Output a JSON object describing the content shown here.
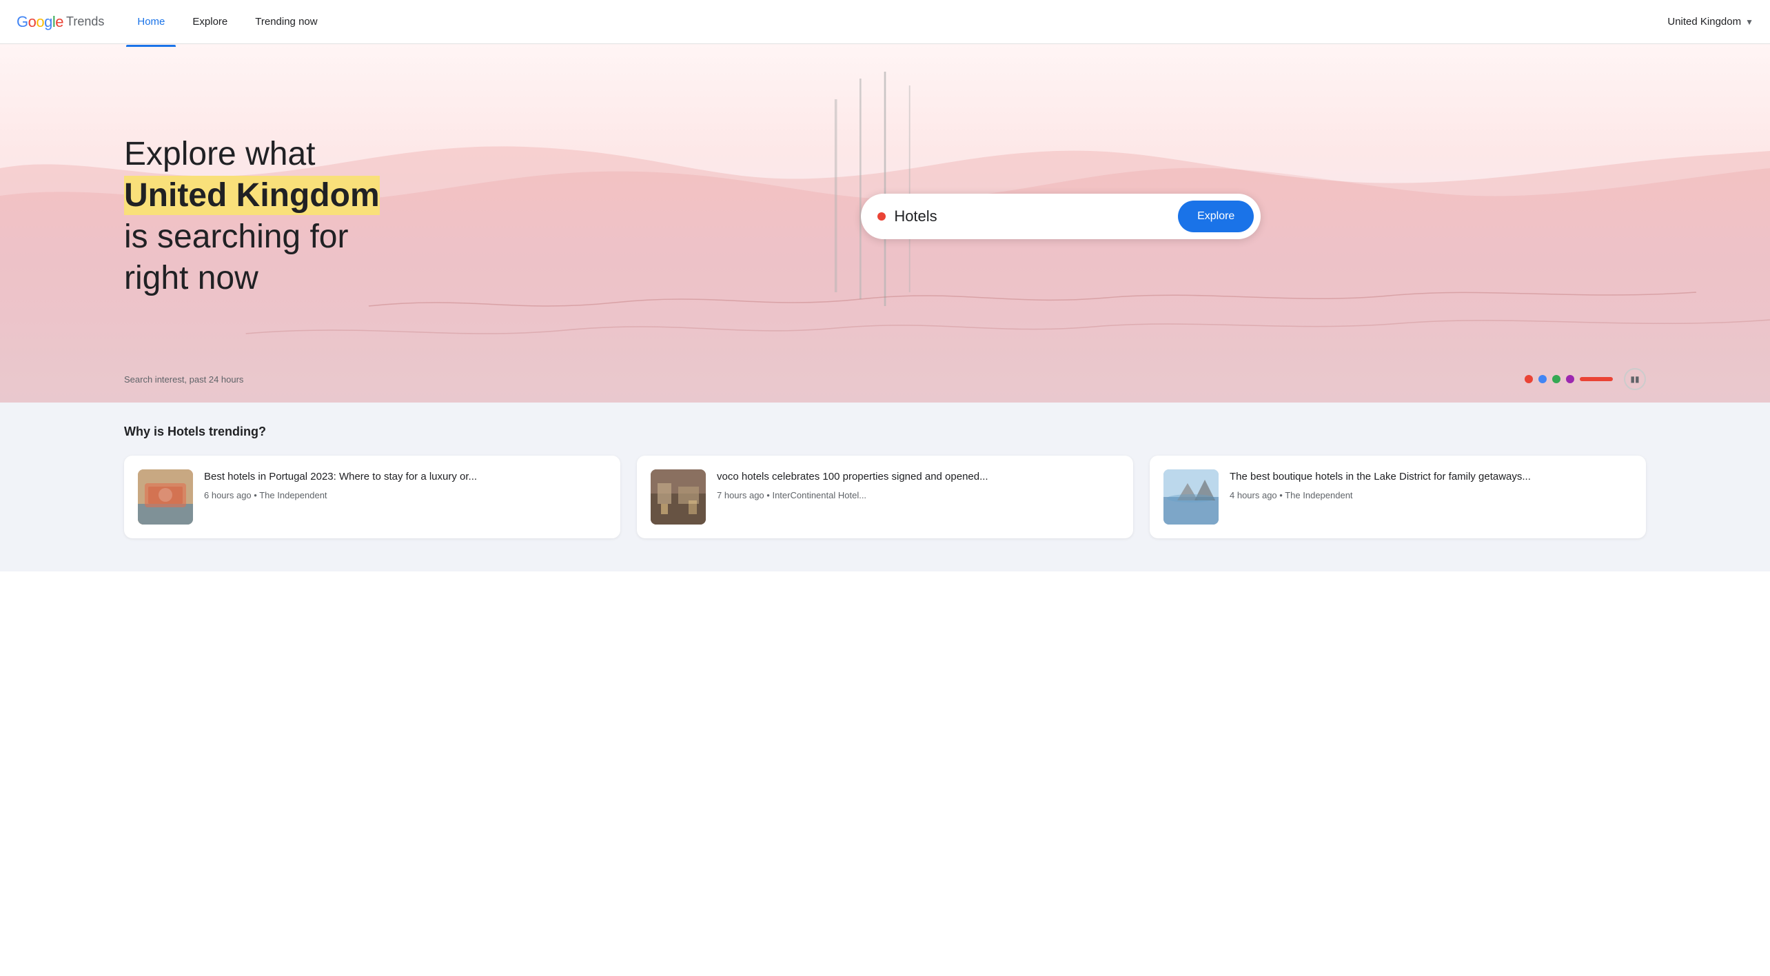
{
  "header": {
    "logo_google": "Google",
    "logo_trends": "Trends",
    "nav": [
      {
        "id": "home",
        "label": "Home",
        "active": true
      },
      {
        "id": "explore",
        "label": "Explore",
        "active": false
      },
      {
        "id": "trending",
        "label": "Trending now",
        "active": false
      }
    ],
    "country": "United Kingdom",
    "dropdown_arrow": "▼"
  },
  "hero": {
    "headline_before": "Explore what",
    "headline_highlight": "United Kingdom",
    "headline_after": "is searching for\nright now",
    "search_value": "Hotels",
    "explore_button": "Explore",
    "search_interest_label": "Search interest, past 24 hours"
  },
  "indicators": [
    {
      "color": "#EA4335"
    },
    {
      "color": "#4285F4"
    },
    {
      "color": "#34A853"
    },
    {
      "color": "#9C27B0"
    }
  ],
  "trending": {
    "title_prefix": "Why is ",
    "title_keyword": "Hotels",
    "title_suffix": " trending?",
    "cards": [
      {
        "id": "card-1",
        "headline": "Best hotels in Portugal 2023: Where to stay for a luxury or...",
        "time_ago": "6 hours ago",
        "source": "The Independent",
        "thumb_type": "portugal"
      },
      {
        "id": "card-2",
        "headline": "voco hotels celebrates 100 properties signed and opened...",
        "time_ago": "7 hours ago",
        "source": "InterContinental Hotel...",
        "thumb_type": "hotel"
      },
      {
        "id": "card-3",
        "headline": "The best boutique hotels in the Lake District for family getaways...",
        "time_ago": "4 hours ago",
        "source": "The Independent",
        "thumb_type": "lake"
      }
    ]
  }
}
